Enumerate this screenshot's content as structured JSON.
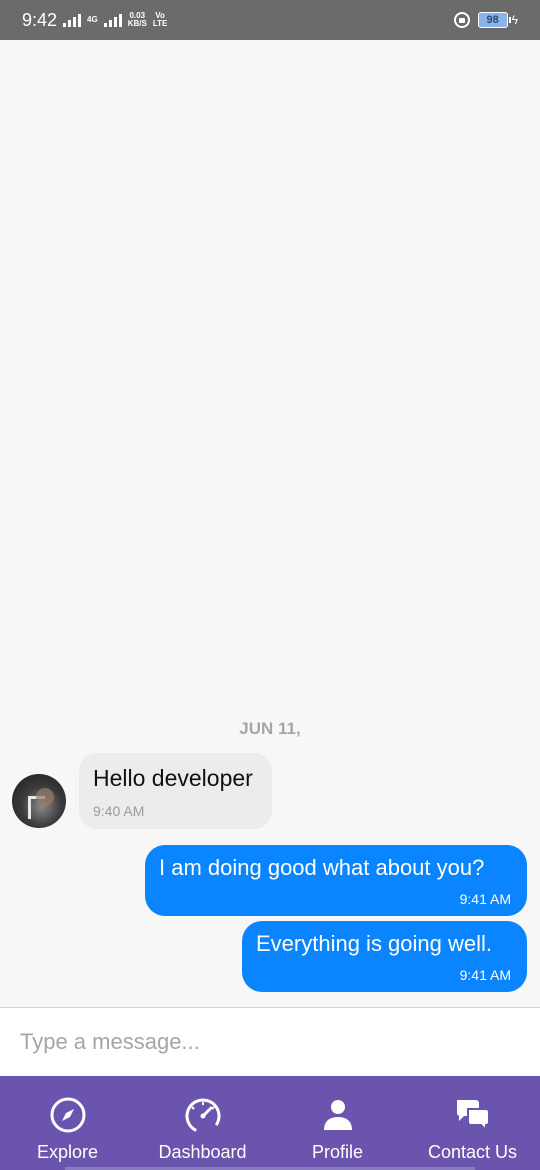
{
  "status_bar": {
    "time": "9:42",
    "net_label_1": "4G",
    "speed_value": "0.03",
    "speed_unit": "KB/S",
    "volte_top": "Vo",
    "volte_bottom": "LTE",
    "battery": "98",
    "icons": [
      "signal-icon",
      "signal-icon",
      "lock-icon",
      "battery-icon",
      "charging-icon"
    ]
  },
  "chat": {
    "date_separator": "JUN 11,",
    "messages": [
      {
        "direction": "incoming",
        "text": "Hello developer",
        "time": "9:40 AM"
      },
      {
        "direction": "outgoing",
        "text": "I am doing good what about you?",
        "time": "9:41 AM"
      },
      {
        "direction": "outgoing",
        "text": "Everything is going well.",
        "time": "9:41 AM"
      }
    ]
  },
  "composer": {
    "placeholder": "Type a message..."
  },
  "bottom_nav": {
    "items": [
      {
        "label": "Explore",
        "icon": "compass-icon"
      },
      {
        "label": "Dashboard",
        "icon": "speedometer-icon"
      },
      {
        "label": "Profile",
        "icon": "person-icon"
      },
      {
        "label": "Contact Us",
        "icon": "chat-bubbles-icon"
      }
    ]
  },
  "colors": {
    "nav_background": "#6b54ad",
    "outgoing_bubble": "#0a84ff",
    "incoming_bubble": "#ececec",
    "status_bar": "#6b6b6b"
  }
}
